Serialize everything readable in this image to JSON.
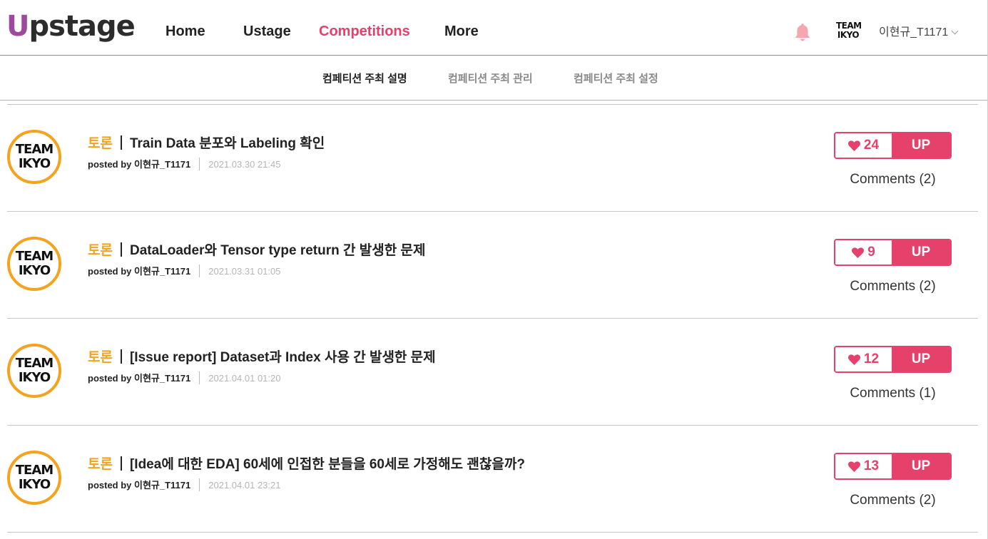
{
  "brand": {
    "logo_u": "U",
    "logo_rest": "pstage"
  },
  "nav": {
    "home": "Home",
    "ustage": "Ustage",
    "competitions": "Competitions",
    "more": "More"
  },
  "user": {
    "team_line1": "TEAM",
    "team_line2": "IKYO",
    "name": "이현규_T1171"
  },
  "subnav": {
    "tab1": "컴페티션 주최 설명",
    "tab2": "컴페티션 주최 관리",
    "tab3": "컴페티션 주최 설정"
  },
  "colors": {
    "accent": "#e5416a",
    "category": "#f5a21f",
    "avatar_ring": "#f5a21f"
  },
  "posts": [
    {
      "avatar_l1": "TEAM",
      "avatar_l2": "IKYO",
      "category": "토론",
      "title": "Train Data 분포와 Labeling 확인",
      "author": "posted by 이현규_T1171",
      "date": "2021.03.30 21:45",
      "likes": "24",
      "up": "UP",
      "comments": "Comments (2)"
    },
    {
      "avatar_l1": "TEAM",
      "avatar_l2": "IKYO",
      "category": "토론",
      "title": "DataLoader와 Tensor type return 간 발생한 문제",
      "author": "posted by 이현규_T1171",
      "date": "2021.03.31 01:05",
      "likes": "9",
      "up": "UP",
      "comments": "Comments (2)"
    },
    {
      "avatar_l1": "TEAM",
      "avatar_l2": "IKYO",
      "category": "토론",
      "title": "[Issue report] Dataset과 Index 사용 간 발생한 문제",
      "author": "posted by 이현규_T1171",
      "date": "2021.04.01 01:20",
      "likes": "12",
      "up": "UP",
      "comments": "Comments (1)"
    },
    {
      "avatar_l1": "TEAM",
      "avatar_l2": "IKYO",
      "category": "토론",
      "title": "[Idea에 대한 EDA] 60세에 인접한 분들을 60세로 가정해도 괜찮을까?",
      "author": "posted by 이현규_T1171",
      "date": "2021.04.01 23:21",
      "likes": "13",
      "up": "UP",
      "comments": "Comments (2)"
    }
  ]
}
